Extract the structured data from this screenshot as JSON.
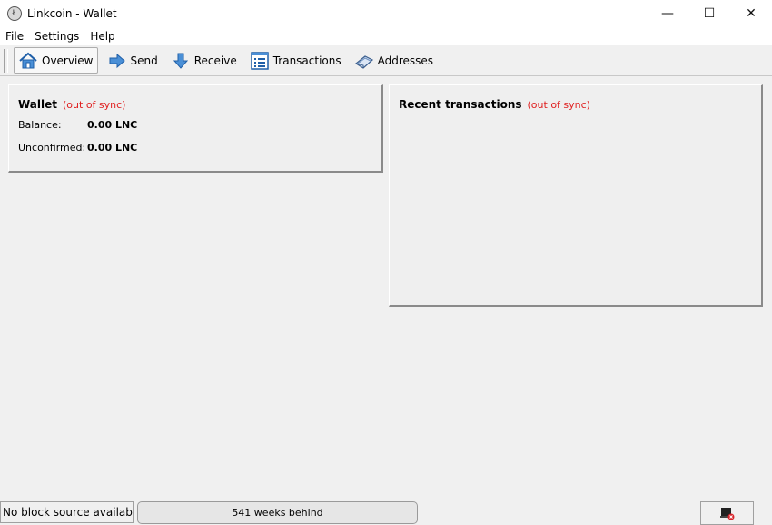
{
  "window": {
    "title": "Linkcoin - Wallet",
    "app_icon_glyph": "Ł",
    "minimize_glyph": "—",
    "maximize_glyph": "☐",
    "close_glyph": "✕"
  },
  "menu": {
    "items": [
      {
        "label": "File"
      },
      {
        "label": "Settings"
      },
      {
        "label": "Help"
      }
    ]
  },
  "toolbar": {
    "items": [
      {
        "label": "Overview",
        "icon": "home-icon",
        "active": true
      },
      {
        "label": "Send",
        "icon": "send-arrow-icon"
      },
      {
        "label": "Receive",
        "icon": "receive-arrow-icon"
      },
      {
        "label": "Transactions",
        "icon": "transactions-list-icon"
      },
      {
        "label": "Addresses",
        "icon": "address-book-icon"
      }
    ]
  },
  "wallet": {
    "title": "Wallet",
    "sync_status": "(out of sync)",
    "balance_label": "Balance:",
    "balance_value": "0.00 LNC",
    "unconfirmed_label": "Unconfirmed:",
    "unconfirmed_value": "0.00 LNC"
  },
  "recent": {
    "title": "Recent transactions",
    "sync_status": "(out of sync)"
  },
  "statusbar": {
    "left_text": "No block source available...",
    "progress_text": "541 weeks behind",
    "connection_icon": "network-disconnected-icon"
  },
  "colors": {
    "out_of_sync": "#e02020",
    "background": "#f0f0f0"
  }
}
